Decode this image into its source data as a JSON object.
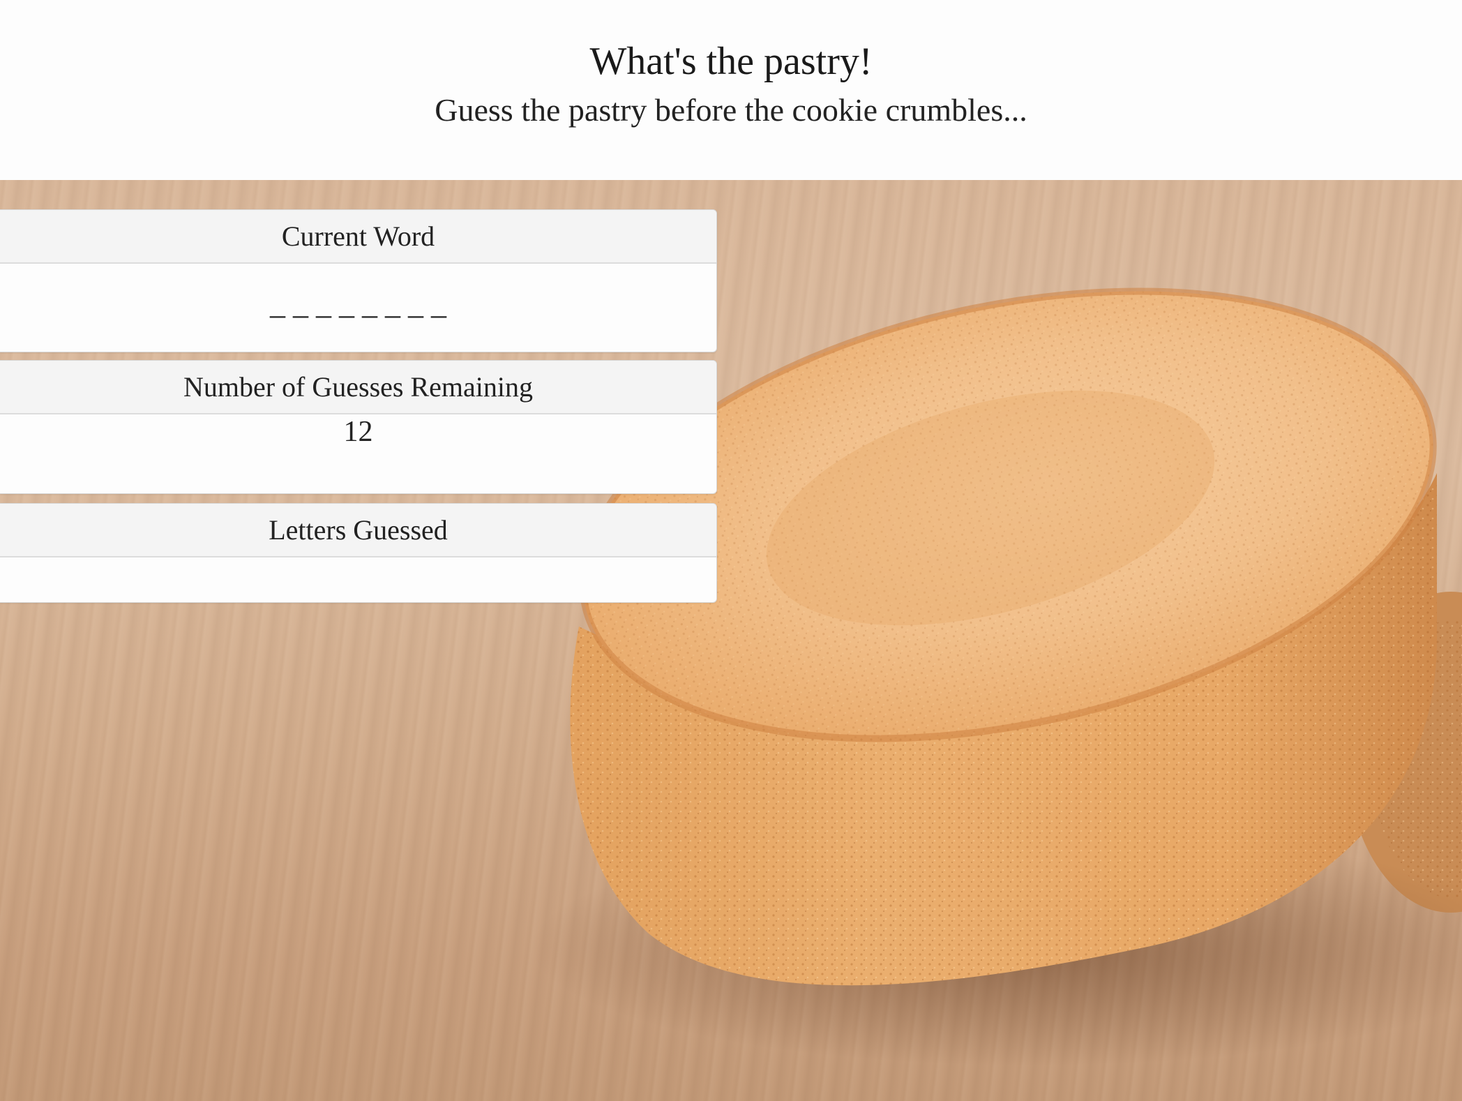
{
  "header": {
    "title": "What's the pastry!",
    "subtitle": "Guess the pastry before the cookie crumbles..."
  },
  "panels": {
    "current_word": {
      "heading": "Current Word",
      "value": "_ _ _ _ _ _ _ _"
    },
    "guesses_remaining": {
      "heading": "Number of Guesses Remaining",
      "value": "12"
    },
    "letters_guessed": {
      "heading": "Letters Guessed",
      "value": ""
    }
  },
  "background": {
    "image": "pastry-cake-on-wooden-board",
    "colors": {
      "wood": "#d6b293",
      "cake_top": "#f0c08d",
      "cake_side": "#e9a860"
    }
  }
}
